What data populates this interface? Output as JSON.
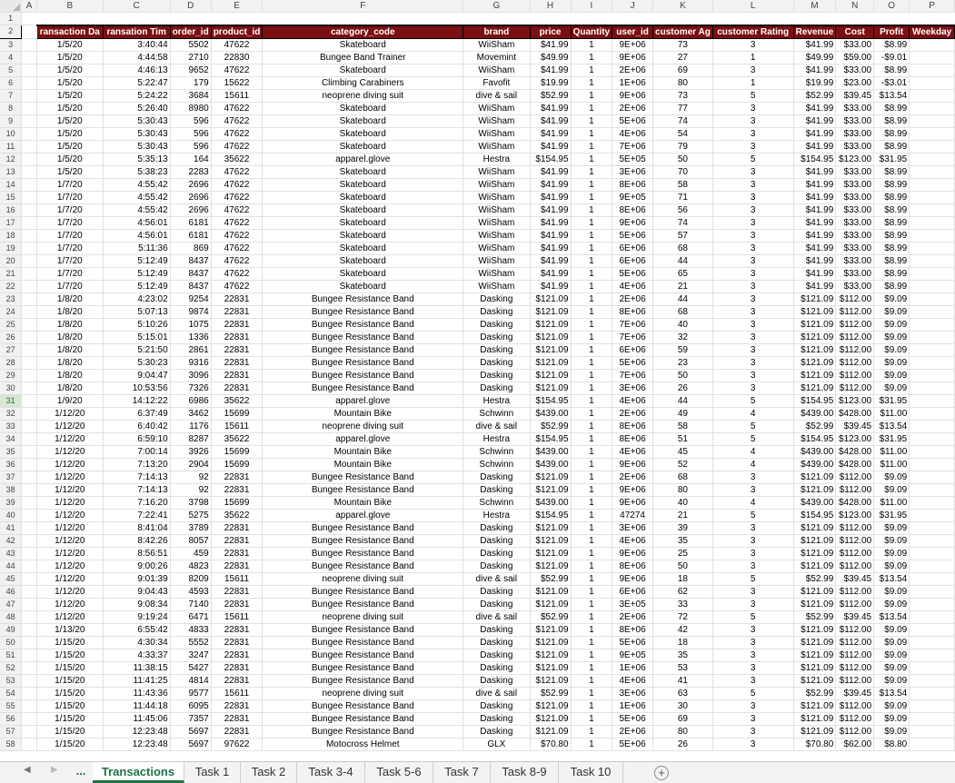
{
  "sheet": {
    "columns": [
      "A",
      "B",
      "C",
      "D",
      "E",
      "F",
      "G",
      "H",
      "I",
      "J",
      "K",
      "L",
      "M",
      "N",
      "O",
      "P"
    ],
    "header_row_label": "2",
    "headers": [
      "ransaction Da",
      "ransation Tim",
      "order_id",
      "product_id",
      "category_code",
      "brand",
      "price",
      "Quantity",
      "user_id",
      "customer Ag",
      "customer Rating",
      "Revenue",
      "Cost",
      "Profit",
      "Weekday"
    ],
    "rows": [
      [
        "3",
        "1/5/20",
        "3:40:44",
        "5502",
        "47622",
        "Skateboard",
        "WiiSham",
        "$41.99",
        "1",
        "9E+06",
        "73",
        "3",
        "$41.99",
        "$33.00",
        "$8.99"
      ],
      [
        "4",
        "1/5/20",
        "4:44:58",
        "2710",
        "22830",
        "Bungee Band Trainer",
        "Movemint",
        "$49.99",
        "1",
        "9E+06",
        "27",
        "1",
        "$49.99",
        "$59.00",
        "-$9.01"
      ],
      [
        "5",
        "1/5/20",
        "4:46:13",
        "9652",
        "47622",
        "Skateboard",
        "WiiSham",
        "$41.99",
        "1",
        "2E+06",
        "69",
        "3",
        "$41.99",
        "$33.00",
        "$8.99"
      ],
      [
        "6",
        "1/5/20",
        "5:22:47",
        "179",
        "15622",
        "Climbing Carabiners",
        "Favofit",
        "$19.99",
        "1",
        "1E+06",
        "80",
        "1",
        "$19.99",
        "$23.00",
        "-$3.01"
      ],
      [
        "7",
        "1/5/20",
        "5:24:22",
        "3684",
        "15611",
        "neoprene diving suit",
        "dive & sail",
        "$52.99",
        "1",
        "9E+06",
        "73",
        "5",
        "$52.99",
        "$39.45",
        "$13.54"
      ],
      [
        "8",
        "1/5/20",
        "5:26:40",
        "8980",
        "47622",
        "Skateboard",
        "WiiSham",
        "$41.99",
        "1",
        "2E+06",
        "77",
        "3",
        "$41.99",
        "$33.00",
        "$8.99"
      ],
      [
        "9",
        "1/5/20",
        "5:30:43",
        "596",
        "47622",
        "Skateboard",
        "WiiSham",
        "$41.99",
        "1",
        "5E+06",
        "74",
        "3",
        "$41.99",
        "$33.00",
        "$8.99"
      ],
      [
        "10",
        "1/5/20",
        "5:30:43",
        "596",
        "47622",
        "Skateboard",
        "WiiSham",
        "$41.99",
        "1",
        "4E+06",
        "54",
        "3",
        "$41.99",
        "$33.00",
        "$8.99"
      ],
      [
        "11",
        "1/5/20",
        "5:30:43",
        "596",
        "47622",
        "Skateboard",
        "WiiSham",
        "$41.99",
        "1",
        "7E+06",
        "79",
        "3",
        "$41.99",
        "$33.00",
        "$8.99"
      ],
      [
        "12",
        "1/5/20",
        "5:35:13",
        "164",
        "35622",
        "apparel.glove",
        "Hestra",
        "$154.95",
        "1",
        "5E+05",
        "50",
        "5",
        "$154.95",
        "$123.00",
        "$31.95"
      ],
      [
        "13",
        "1/5/20",
        "5:38:23",
        "2283",
        "47622",
        "Skateboard",
        "WiiSham",
        "$41.99",
        "1",
        "3E+06",
        "70",
        "3",
        "$41.99",
        "$33.00",
        "$8.99"
      ],
      [
        "14",
        "1/7/20",
        "4:55:42",
        "2696",
        "47622",
        "Skateboard",
        "WiiSham",
        "$41.99",
        "1",
        "8E+06",
        "58",
        "3",
        "$41.99",
        "$33.00",
        "$8.99"
      ],
      [
        "15",
        "1/7/20",
        "4:55:42",
        "2696",
        "47622",
        "Skateboard",
        "WiiSham",
        "$41.99",
        "1",
        "9E+05",
        "71",
        "3",
        "$41.99",
        "$33.00",
        "$8.99"
      ],
      [
        "16",
        "1/7/20",
        "4:55:42",
        "2696",
        "47622",
        "Skateboard",
        "WiiSham",
        "$41.99",
        "1",
        "8E+06",
        "56",
        "3",
        "$41.99",
        "$33.00",
        "$8.99"
      ],
      [
        "17",
        "1/7/20",
        "4:56:01",
        "6181",
        "47622",
        "Skateboard",
        "WiiSham",
        "$41.99",
        "1",
        "9E+06",
        "74",
        "3",
        "$41.99",
        "$33.00",
        "$8.99"
      ],
      [
        "18",
        "1/7/20",
        "4:56:01",
        "6181",
        "47622",
        "Skateboard",
        "WiiSham",
        "$41.99",
        "1",
        "5E+06",
        "57",
        "3",
        "$41.99",
        "$33.00",
        "$8.99"
      ],
      [
        "19",
        "1/7/20",
        "5:11:36",
        "869",
        "47622",
        "Skateboard",
        "WiiSham",
        "$41.99",
        "1",
        "6E+06",
        "68",
        "3",
        "$41.99",
        "$33.00",
        "$8.99"
      ],
      [
        "20",
        "1/7/20",
        "5:12:49",
        "8437",
        "47622",
        "Skateboard",
        "WiiSham",
        "$41.99",
        "1",
        "6E+06",
        "44",
        "3",
        "$41.99",
        "$33.00",
        "$8.99"
      ],
      [
        "21",
        "1/7/20",
        "5:12:49",
        "8437",
        "47622",
        "Skateboard",
        "WiiSham",
        "$41.99",
        "1",
        "5E+06",
        "65",
        "3",
        "$41.99",
        "$33.00",
        "$8.99"
      ],
      [
        "22",
        "1/7/20",
        "5:12:49",
        "8437",
        "47622",
        "Skateboard",
        "WiiSham",
        "$41.99",
        "1",
        "4E+06",
        "21",
        "3",
        "$41.99",
        "$33.00",
        "$8.99"
      ],
      [
        "23",
        "1/8/20",
        "4:23:02",
        "9254",
        "22831",
        "Bungee Resistance Band",
        "Dasking",
        "$121.09",
        "1",
        "2E+06",
        "44",
        "3",
        "$121.09",
        "$112.00",
        "$9.09"
      ],
      [
        "24",
        "1/8/20",
        "5:07:13",
        "9874",
        "22831",
        "Bungee Resistance Band",
        "Dasking",
        "$121.09",
        "1",
        "8E+06",
        "68",
        "3",
        "$121.09",
        "$112.00",
        "$9.09"
      ],
      [
        "25",
        "1/8/20",
        "5:10:26",
        "1075",
        "22831",
        "Bungee Resistance Band",
        "Dasking",
        "$121.09",
        "1",
        "7E+06",
        "40",
        "3",
        "$121.09",
        "$112.00",
        "$9.09"
      ],
      [
        "26",
        "1/8/20",
        "5:15:01",
        "1336",
        "22831",
        "Bungee Resistance Band",
        "Dasking",
        "$121.09",
        "1",
        "7E+06",
        "32",
        "3",
        "$121.09",
        "$112.00",
        "$9.09"
      ],
      [
        "27",
        "1/8/20",
        "5:21:50",
        "2861",
        "22831",
        "Bungee Resistance Band",
        "Dasking",
        "$121.09",
        "1",
        "6E+06",
        "59",
        "3",
        "$121.09",
        "$112.00",
        "$9.09"
      ],
      [
        "28",
        "1/8/20",
        "5:30:23",
        "9316",
        "22831",
        "Bungee Resistance Band",
        "Dasking",
        "$121.09",
        "1",
        "5E+06",
        "23",
        "3",
        "$121.09",
        "$112.00",
        "$9.09"
      ],
      [
        "29",
        "1/8/20",
        "9:04:47",
        "3096",
        "22831",
        "Bungee Resistance Band",
        "Dasking",
        "$121.09",
        "1",
        "7E+06",
        "50",
        "3",
        "$121.09",
        "$112.00",
        "$9.09"
      ],
      [
        "30",
        "1/8/20",
        "10:53:56",
        "7326",
        "22831",
        "Bungee Resistance Band",
        "Dasking",
        "$121.09",
        "1",
        "3E+06",
        "26",
        "3",
        "$121.09",
        "$112.00",
        "$9.09"
      ],
      [
        "31",
        "1/9/20",
        "14:12:22",
        "6986",
        "35622",
        "apparel.glove",
        "Hestra",
        "$154.95",
        "1",
        "4E+06",
        "44",
        "5",
        "$154.95",
        "$123.00",
        "$31.95"
      ],
      [
        "32",
        "1/12/20",
        "6:37:49",
        "3462",
        "15699",
        "Mountain Bike",
        "Schwinn",
        "$439.00",
        "1",
        "2E+06",
        "49",
        "4",
        "$439.00",
        "$428.00",
        "$11.00"
      ],
      [
        "33",
        "1/12/20",
        "6:40:42",
        "1176",
        "15611",
        "neoprene diving suit",
        "dive & sail",
        "$52.99",
        "1",
        "8E+06",
        "58",
        "5",
        "$52.99",
        "$39.45",
        "$13.54"
      ],
      [
        "34",
        "1/12/20",
        "6:59:10",
        "8287",
        "35622",
        "apparel.glove",
        "Hestra",
        "$154.95",
        "1",
        "8E+06",
        "51",
        "5",
        "$154.95",
        "$123.00",
        "$31.95"
      ],
      [
        "35",
        "1/12/20",
        "7:00:14",
        "3926",
        "15699",
        "Mountain Bike",
        "Schwinn",
        "$439.00",
        "1",
        "4E+06",
        "45",
        "4",
        "$439.00",
        "$428.00",
        "$11.00"
      ],
      [
        "36",
        "1/12/20",
        "7:13:20",
        "2904",
        "15699",
        "Mountain Bike",
        "Schwinn",
        "$439.00",
        "1",
        "9E+06",
        "52",
        "4",
        "$439.00",
        "$428.00",
        "$11.00"
      ],
      [
        "37",
        "1/12/20",
        "7:14:13",
        "92",
        "22831",
        "Bungee Resistance Band",
        "Dasking",
        "$121.09",
        "1",
        "2E+06",
        "68",
        "3",
        "$121.09",
        "$112.00",
        "$9.09"
      ],
      [
        "38",
        "1/12/20",
        "7:14:13",
        "92",
        "22831",
        "Bungee Resistance Band",
        "Dasking",
        "$121.09",
        "1",
        "9E+06",
        "80",
        "3",
        "$121.09",
        "$112.00",
        "$9.09"
      ],
      [
        "39",
        "1/12/20",
        "7:16:20",
        "3798",
        "15699",
        "Mountain Bike",
        "Schwinn",
        "$439.00",
        "1",
        "9E+06",
        "40",
        "4",
        "$439.00",
        "$428.00",
        "$11.00"
      ],
      [
        "40",
        "1/12/20",
        "7:22:41",
        "5275",
        "35622",
        "apparel.glove",
        "Hestra",
        "$154.95",
        "1",
        "47274",
        "21",
        "5",
        "$154.95",
        "$123.00",
        "$31.95"
      ],
      [
        "41",
        "1/12/20",
        "8:41:04",
        "3789",
        "22831",
        "Bungee Resistance Band",
        "Dasking",
        "$121.09",
        "1",
        "3E+06",
        "39",
        "3",
        "$121.09",
        "$112.00",
        "$9.09"
      ],
      [
        "42",
        "1/12/20",
        "8:42:26",
        "8057",
        "22831",
        "Bungee Resistance Band",
        "Dasking",
        "$121.09",
        "1",
        "4E+06",
        "35",
        "3",
        "$121.09",
        "$112.00",
        "$9.09"
      ],
      [
        "43",
        "1/12/20",
        "8:56:51",
        "459",
        "22831",
        "Bungee Resistance Band",
        "Dasking",
        "$121.09",
        "1",
        "9E+06",
        "25",
        "3",
        "$121.09",
        "$112.00",
        "$9.09"
      ],
      [
        "44",
        "1/12/20",
        "9:00:26",
        "4823",
        "22831",
        "Bungee Resistance Band",
        "Dasking",
        "$121.09",
        "1",
        "8E+06",
        "50",
        "3",
        "$121.09",
        "$112.00",
        "$9.09"
      ],
      [
        "45",
        "1/12/20",
        "9:01:39",
        "8209",
        "15611",
        "neoprene diving suit",
        "dive & sail",
        "$52.99",
        "1",
        "9E+06",
        "18",
        "5",
        "$52.99",
        "$39.45",
        "$13.54"
      ],
      [
        "46",
        "1/12/20",
        "9:04:43",
        "4593",
        "22831",
        "Bungee Resistance Band",
        "Dasking",
        "$121.09",
        "1",
        "6E+06",
        "62",
        "3",
        "$121.09",
        "$112.00",
        "$9.09"
      ],
      [
        "47",
        "1/12/20",
        "9:08:34",
        "7140",
        "22831",
        "Bungee Resistance Band",
        "Dasking",
        "$121.09",
        "1",
        "3E+05",
        "33",
        "3",
        "$121.09",
        "$112.00",
        "$9.09"
      ],
      [
        "48",
        "1/12/20",
        "9:19:24",
        "6471",
        "15611",
        "neoprene diving suit",
        "dive & sail",
        "$52.99",
        "1",
        "2E+06",
        "72",
        "5",
        "$52.99",
        "$39.45",
        "$13.54"
      ],
      [
        "49",
        "1/13/20",
        "6:55:42",
        "4833",
        "22831",
        "Bungee Resistance Band",
        "Dasking",
        "$121.09",
        "1",
        "8E+06",
        "42",
        "3",
        "$121.09",
        "$112.00",
        "$9.09"
      ],
      [
        "50",
        "1/15/20",
        "4:30:34",
        "5552",
        "22831",
        "Bungee Resistance Band",
        "Dasking",
        "$121.09",
        "1",
        "5E+06",
        "18",
        "3",
        "$121.09",
        "$112.00",
        "$9.09"
      ],
      [
        "51",
        "1/15/20",
        "4:33:37",
        "3247",
        "22831",
        "Bungee Resistance Band",
        "Dasking",
        "$121.09",
        "1",
        "9E+05",
        "35",
        "3",
        "$121.09",
        "$112.00",
        "$9.09"
      ],
      [
        "52",
        "1/15/20",
        "11:38:15",
        "5427",
        "22831",
        "Bungee Resistance Band",
        "Dasking",
        "$121.09",
        "1",
        "1E+06",
        "53",
        "3",
        "$121.09",
        "$112.00",
        "$9.09"
      ],
      [
        "53",
        "1/15/20",
        "11:41:25",
        "4814",
        "22831",
        "Bungee Resistance Band",
        "Dasking",
        "$121.09",
        "1",
        "4E+06",
        "41",
        "3",
        "$121.09",
        "$112.00",
        "$9.09"
      ],
      [
        "54",
        "1/15/20",
        "11:43:36",
        "9577",
        "15611",
        "neoprene diving suit",
        "dive & sail",
        "$52.99",
        "1",
        "3E+06",
        "63",
        "5",
        "$52.99",
        "$39.45",
        "$13.54"
      ],
      [
        "55",
        "1/15/20",
        "11:44:18",
        "6095",
        "22831",
        "Bungee Resistance Band",
        "Dasking",
        "$121.09",
        "1",
        "1E+06",
        "30",
        "3",
        "$121.09",
        "$112.00",
        "$9.09"
      ],
      [
        "56",
        "1/15/20",
        "11:45:06",
        "7357",
        "22831",
        "Bungee Resistance Band",
        "Dasking",
        "$121.09",
        "1",
        "5E+06",
        "69",
        "3",
        "$121.09",
        "$112.00",
        "$9.09"
      ],
      [
        "57",
        "1/15/20",
        "12:23:48",
        "5697",
        "22831",
        "Bungee Resistance Band",
        "Dasking",
        "$121.09",
        "1",
        "2E+06",
        "80",
        "3",
        "$121.09",
        "$112.00",
        "$9.09"
      ],
      [
        "58",
        "1/15/20",
        "12:23:48",
        "5697",
        "97622",
        "Motocross Helmet",
        "GLX",
        "$70.80",
        "1",
        "5E+06",
        "26",
        "3",
        "$70.80",
        "$62.00",
        "$8.80"
      ]
    ]
  },
  "tabs": {
    "ellipsis": "...",
    "items": [
      "Transactions",
      "Task 1",
      "Task 2",
      "Task 3-4",
      "Task 5-6",
      "Task 7",
      "Task 8-9",
      "Task 10"
    ],
    "active": "Transactions",
    "add_label": "+"
  },
  "icons": {
    "prev": "prev-sheet-icon",
    "next": "next-sheet-icon",
    "add": "add-sheet-icon"
  }
}
